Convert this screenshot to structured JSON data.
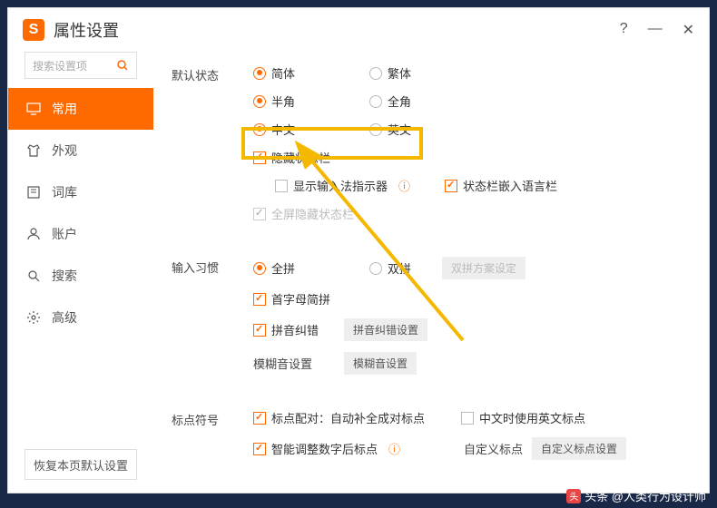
{
  "window": {
    "title": "属性设置",
    "logo_text": "S",
    "help": "?",
    "min": "—",
    "close": "✕"
  },
  "sidebar": {
    "search_placeholder": "搜索设置项",
    "items": [
      {
        "label": "常用"
      },
      {
        "label": "外观"
      },
      {
        "label": "词库"
      },
      {
        "label": "账户"
      },
      {
        "label": "搜索"
      },
      {
        "label": "高级"
      }
    ],
    "restore": "恢复本页默认设置"
  },
  "sections": {
    "default_state": {
      "label": "默认状态",
      "rows": [
        {
          "opts": [
            "简体",
            "繁体"
          ],
          "sel": 0
        },
        {
          "opts": [
            "半角",
            "全角"
          ],
          "sel": 0
        },
        {
          "opts": [
            "中文",
            "英文"
          ],
          "sel": 0
        }
      ],
      "hide_status": "隐藏状态栏",
      "show_indicator": "显示输入法指示器",
      "embed_lang": "状态栏嵌入语言栏",
      "fullscreen_hide": "全屏隐藏状态栏"
    },
    "input_habit": {
      "label": "输入习惯",
      "pinyin_opts": [
        "全拼",
        "双拼"
      ],
      "shuangpin_btn": "双拼方案设定",
      "initial": "首字母简拼",
      "correction": "拼音纠错",
      "correction_btn": "拼音纠错设置",
      "fuzzy": "模糊音设置",
      "fuzzy_btn": "模糊音设置"
    },
    "punctuation": {
      "label": "标点符号",
      "pair": "标点配对：自动补全成对标点",
      "en_punct": "中文时使用英文标点",
      "smart_num": "智能调整数字后标点",
      "custom": "自定义标点",
      "custom_btn": "自定义标点设置"
    }
  },
  "watermark": "头条 @人类行为设计师"
}
